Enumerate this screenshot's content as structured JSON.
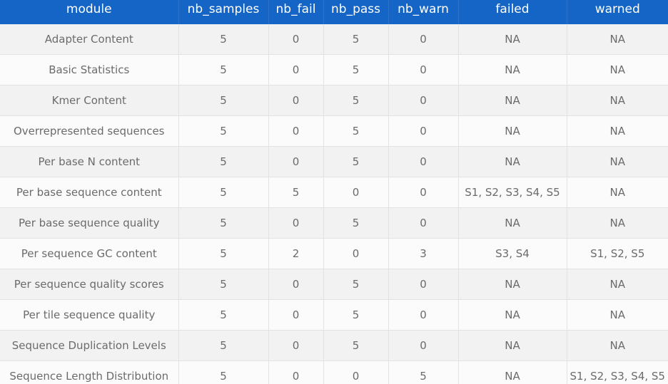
{
  "table": {
    "columns": [
      "module",
      "nb_samples",
      "nb_fail",
      "nb_pass",
      "nb_warn",
      "failed",
      "warned"
    ],
    "rows": [
      [
        "Adapter Content",
        "5",
        "0",
        "5",
        "0",
        "NA",
        "NA"
      ],
      [
        "Basic Statistics",
        "5",
        "0",
        "5",
        "0",
        "NA",
        "NA"
      ],
      [
        "Kmer Content",
        "5",
        "0",
        "5",
        "0",
        "NA",
        "NA"
      ],
      [
        "Overrepresented sequences",
        "5",
        "0",
        "5",
        "0",
        "NA",
        "NA"
      ],
      [
        "Per base N content",
        "5",
        "0",
        "5",
        "0",
        "NA",
        "NA"
      ],
      [
        "Per base sequence content",
        "5",
        "5",
        "0",
        "0",
        "S1, S2, S3, S4, S5",
        "NA"
      ],
      [
        "Per base sequence quality",
        "5",
        "0",
        "5",
        "0",
        "NA",
        "NA"
      ],
      [
        "Per sequence GC content",
        "5",
        "2",
        "0",
        "3",
        "S3, S4",
        "S1, S2, S5"
      ],
      [
        "Per sequence quality scores",
        "5",
        "0",
        "5",
        "0",
        "NA",
        "NA"
      ],
      [
        "Per tile sequence quality",
        "5",
        "0",
        "5",
        "0",
        "NA",
        "NA"
      ],
      [
        "Sequence Duplication Levels",
        "5",
        "0",
        "5",
        "0",
        "NA",
        "NA"
      ],
      [
        "Sequence Length Distribution",
        "5",
        "0",
        "0",
        "5",
        "NA",
        "S1, S2, S3, S4, S5"
      ]
    ]
  },
  "colors": {
    "header_bg": "#1565c6",
    "header_text": "#ffffff",
    "row_odd": "#f2f2f2",
    "row_even": "#fbfbfb",
    "cell_text": "#6b6b6b"
  }
}
